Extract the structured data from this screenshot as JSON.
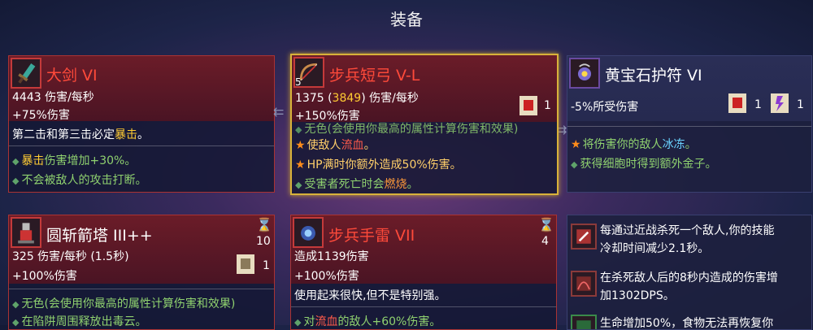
{
  "header": {
    "title": "装备"
  },
  "card1": {
    "name": "大剑 VI",
    "stat1": "4443 伤害/每秒",
    "stat2": "+75%伤害",
    "desc_pre": "第二击和第三击必定",
    "desc_hl": "暴击",
    "desc_post": "。",
    "a1_hl": "暴击",
    "a1_rest": "伤害增加+30%。",
    "a2": "不会被敌人的攻击打断。"
  },
  "card2": {
    "name": "步兵短弓 V-L",
    "level_badge": "5",
    "stat1_a": "1375 (",
    "stat1_b": "3849",
    "stat1_c": ") 伤害/每秒",
    "stat2": "+150%伤害",
    "scroll_count": "1",
    "partial": "无色(会使用你最高的属性计算伤害和效果)",
    "a1_pre": "使敌人",
    "a1_hl": "流血",
    "a1_post": "。",
    "a2": "HP满时你额外造成50%伤害。",
    "a3_pre": "受害者死亡时会",
    "a3_hl": "燃烧",
    "a3_post": "。"
  },
  "card3": {
    "name": "黄宝石护符 VI",
    "stat1": "-5%所受伤害",
    "count1": "1",
    "count2": "1",
    "a1_pre": "将伤害你的敌人",
    "a1_hl": "冰冻",
    "a1_post": "。",
    "a2": "获得细胞时得到额外金子。"
  },
  "card4": {
    "name": "圆斩箭塔 III++",
    "cooldown": "10",
    "stat1": "325 伤害/每秒 (1.5秒)",
    "stat2": "+100%伤害",
    "scroll_count": "1",
    "a1": "无色(会使用你最高的属性计算伤害和效果)",
    "a2": "在陷阱周围释放出毒云。"
  },
  "card5": {
    "name": "步兵手雷 VII",
    "cooldown": "4",
    "stat1": "造成1139伤害",
    "stat2": "+100%伤害",
    "desc": "使用起来很快,但不是特别强。",
    "a1_pre": "对",
    "a1_hl": "流血",
    "a1_post": "的敌人+60%伤害。"
  },
  "mutations": [
    {
      "l1": "每通过近战杀死一个敌人,你的技能",
      "l2": "冷却时间减少2.1秒。"
    },
    {
      "l1": "在杀死敌人后的8秒内造成的伤害增",
      "l2": "加1302DPS。"
    },
    {
      "l1": "生命增加50%，食物无法再恢复你"
    }
  ]
}
